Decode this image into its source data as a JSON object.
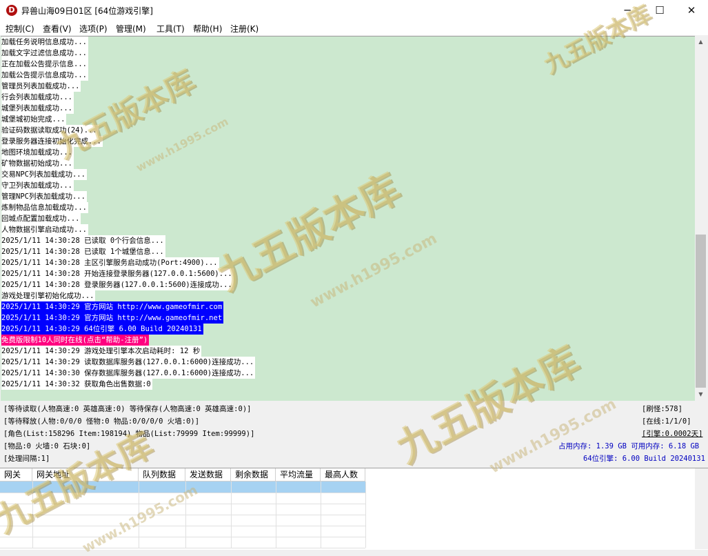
{
  "window": {
    "title": "异兽山海09日01区 [64位游戏引擎]",
    "icon_letter": "D",
    "min_glyph": "─",
    "max_glyph": "☐",
    "close_glyph": "✕"
  },
  "menu": [
    "控制(C)",
    "查看(V)",
    "选项(P)",
    "管理(M)",
    "工具(T)",
    "帮助(H)",
    "注册(K)"
  ],
  "log": [
    {
      "text": "加载任务说明信息成功...",
      "style": "normal"
    },
    {
      "text": "加载文字过滤信息成功...",
      "style": "normal"
    },
    {
      "text": "正在加载公告提示信息...",
      "style": "normal"
    },
    {
      "text": "加载公告提示信息成功...",
      "style": "normal"
    },
    {
      "text": "管理员列表加载成功...",
      "style": "normal"
    },
    {
      "text": "行会列表加载成功...",
      "style": "normal"
    },
    {
      "text": "城堡列表加载成功...",
      "style": "normal"
    },
    {
      "text": "城堡城初始完成...",
      "style": "normal"
    },
    {
      "text": "验证码数据读取成功(24)...",
      "style": "normal"
    },
    {
      "text": "登录服务器连接初始化完成...",
      "style": "normal"
    },
    {
      "text": "地图环境加载成功...",
      "style": "normal"
    },
    {
      "text": "矿物数据初始成功...",
      "style": "normal"
    },
    {
      "text": "交易NPC列表加载成功...",
      "style": "normal"
    },
    {
      "text": "守卫列表加载成功...",
      "style": "normal"
    },
    {
      "text": "管理NPC列表加载成功...",
      "style": "normal"
    },
    {
      "text": "炼制物品信息加载成功...",
      "style": "normal"
    },
    {
      "text": "回城点配置加载成功...",
      "style": "normal"
    },
    {
      "text": "人物数据引擎启动成功...",
      "style": "normal"
    },
    {
      "text": "2025/1/11 14:30:28 已读取 0个行会信息...",
      "style": "normal"
    },
    {
      "text": "2025/1/11 14:30:28 已读取 1个城堡信息...",
      "style": "normal"
    },
    {
      "text": "2025/1/11 14:30:28 主区引擎服务启动成功(Port:4900)...",
      "style": "normal"
    },
    {
      "text": "2025/1/11 14:30:28 开始连接登录服务器(127.0.0.1:5600)...",
      "style": "normal"
    },
    {
      "text": "2025/1/11 14:30:28 登录服务器(127.0.0.1:5600)连接成功...",
      "style": "normal"
    },
    {
      "text": "游戏处理引擎初始化成功...",
      "style": "normal"
    },
    {
      "text": "2025/1/11 14:30:29 官方网站 http://www.gameofmir.com",
      "style": "blue"
    },
    {
      "text": "2025/1/11 14:30:29 官方网站 http://www.gameofmir.net",
      "style": "blue"
    },
    {
      "text": "2025/1/11 14:30:29 64位引擎 6.00 Build 20240131",
      "style": "blue"
    },
    {
      "text": "免费版限制10人同时在线(点击“帮助-注册”)",
      "style": "pink"
    },
    {
      "text": "2025/1/11 14:30:29 游戏处理引擎本次启动耗时: 12 秒",
      "style": "normal"
    },
    {
      "text": "2025/1/11 14:30:29 读取数据库服务器(127.0.0.1:6000)连接成功...",
      "style": "normal"
    },
    {
      "text": "2025/1/11 14:30:30 保存数据库服务器(127.0.0.1:6000)连接成功...",
      "style": "normal"
    },
    {
      "text": "2025/1/11 14:30:32 获取角色出售数据:0",
      "style": "normal"
    }
  ],
  "status": {
    "left": [
      "[等待读取(人物高速:0 英雄高速:0) 等待保存(人物高速:0 英雄高速:0)]",
      "[等待释放(人物:0/0/0 怪物:0 物品:0/0/0/0 火墙:0)]",
      "[角色(List:158296 Item:198194) 物品(List:79999 Item:99999)]",
      "[物品:0 火墙:0 石块:0]",
      "[处理间隔:1]"
    ],
    "refresh": "[刷怪:578]",
    "online": "[在线:1/1/0]",
    "engine_uptime": "[引擎:0.0002天]",
    "memory": "占用内存: 1.39 GB 可用内存: 6.18 GB",
    "version": "64位引擎: 6.00 Build 20240131"
  },
  "gateway_table": {
    "headers": [
      "网关",
      "网关地址",
      "队列数据",
      "发送数据",
      "剩余数据",
      "平均流量",
      "最高人数"
    ],
    "row_count": 6
  },
  "watermark": {
    "text": "九五版本库",
    "url": "www.h1995.com"
  }
}
